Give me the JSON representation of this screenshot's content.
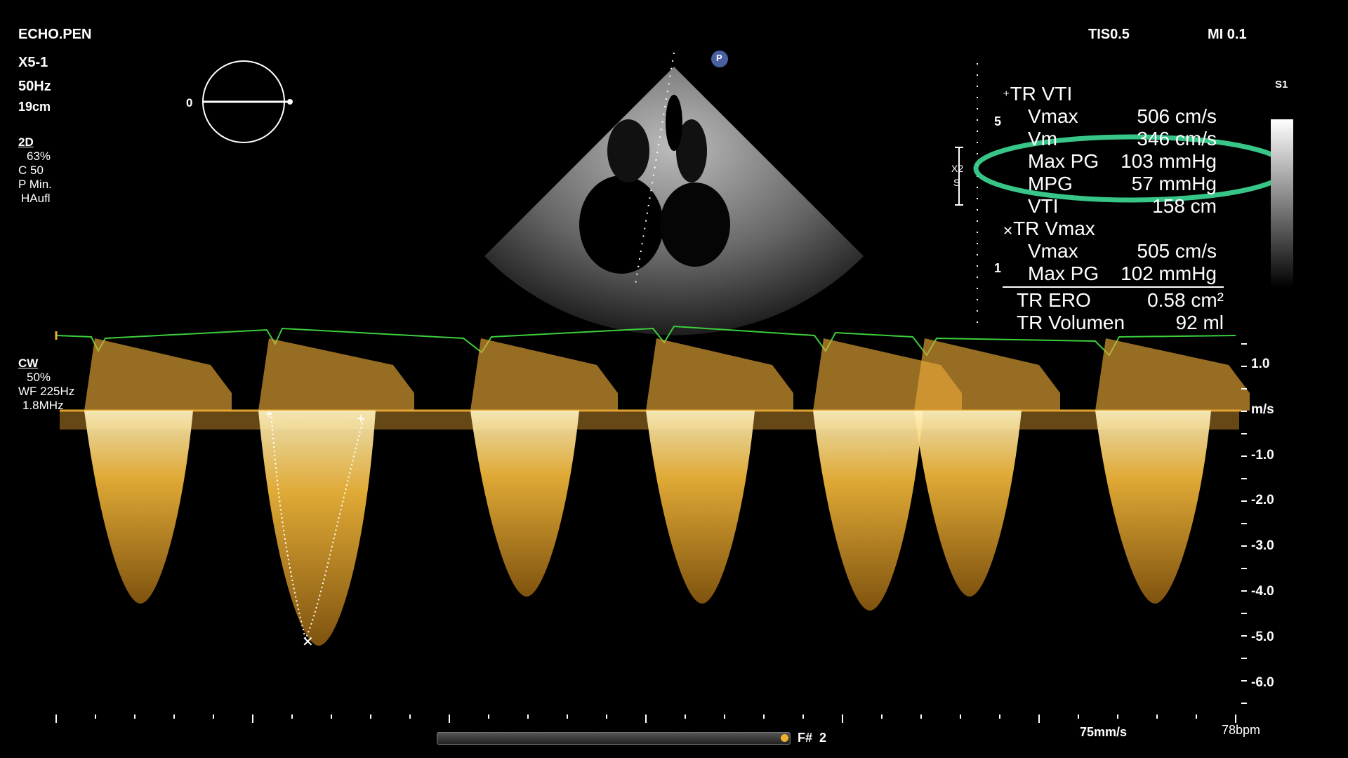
{
  "header": {
    "preset": "ECHO.PEN",
    "probe": "X5-1",
    "frame_rate": "50Hz",
    "depth": "19cm",
    "tis": "TIS0.5",
    "mi": "MI 0.1",
    "grayscale_label": "S1"
  },
  "mode_2d": {
    "title": "2D",
    "gain": "63%",
    "compression": "C 50",
    "power": "P Min.",
    "resolution": "HAufl"
  },
  "angle_indicator": {
    "label": "0"
  },
  "pointer_badge": {
    "label": "P"
  },
  "mode_cw": {
    "title": "CW",
    "gain": "50%",
    "wall_filter": "WF 225Hz",
    "frequency": "1.8MHz"
  },
  "sector_scale": {
    "labels": [
      "5",
      "1"
    ],
    "gate_label": "X2",
    "gate_sub": "S"
  },
  "measurements": {
    "tr_vti": {
      "title": "TR VTI",
      "rows": [
        {
          "label": "Vmax",
          "value": "506 cm/s"
        },
        {
          "label": "Vm",
          "value": "346 cm/s"
        },
        {
          "label": "Max PG",
          "value": "103 mmHg"
        },
        {
          "label": "MPG",
          "value": "57 mmHg"
        },
        {
          "label": "VTI",
          "value": "158 cm"
        }
      ]
    },
    "tr_vmax": {
      "title": "TR Vmax",
      "rows": [
        {
          "label": "Vmax",
          "value": "505 cm/s"
        },
        {
          "label": "Max PG",
          "value": "102 mmHg"
        }
      ]
    },
    "tr_ero": {
      "label": "TR ERO",
      "value": "0.58 cm²"
    },
    "tr_volumen": {
      "label": "TR Volumen",
      "value": "92 ml"
    }
  },
  "velocity_scale": {
    "unit": "m/s",
    "ticks": [
      "1.0",
      "-1.0",
      "-2.0",
      "-3.0",
      "-4.0",
      "-5.0",
      "-6.0"
    ]
  },
  "footer": {
    "sweep_speed": "75mm/s",
    "heart_rate": "78bpm",
    "frame_label": "F#",
    "frame_number": "2"
  },
  "colors": {
    "doppler": "#f0b030",
    "ecg": "#3ccf3c",
    "annotation_ellipse": "#3ddc97"
  }
}
